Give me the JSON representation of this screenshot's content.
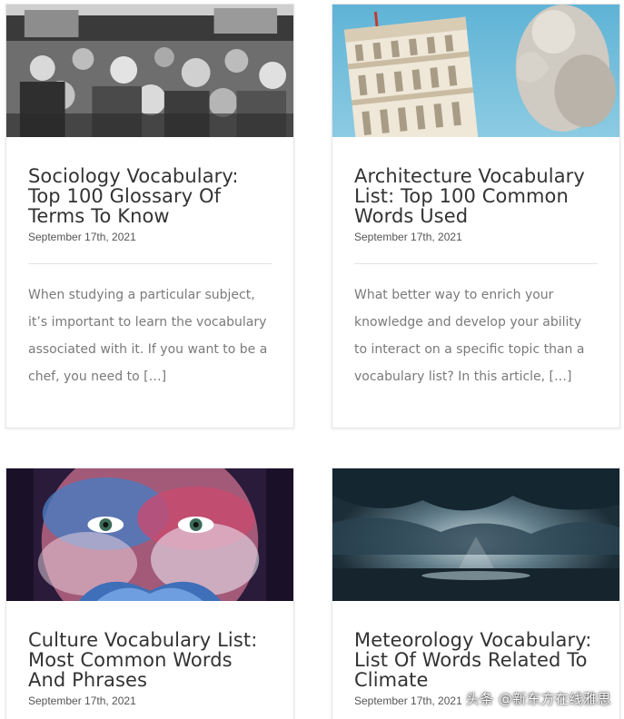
{
  "cards": [
    {
      "title": "Sociology Vocabulary: Top 100 Glossary Of Terms To Know",
      "date": "September 17th, 2021",
      "excerpt": "When studying a particular subject, it’s important to learn the vocabulary associated with it. If you want to be a chef, you need to […]",
      "image": "crowd-photo"
    },
    {
      "title": "Architecture Vocabulary List: Top 100 Common Words Used",
      "date": "September 17th, 2021",
      "excerpt": "What better way to enrich your knowledge and develop your ability to interact on a specific topic than a vocabulary list? In this article, […]",
      "image": "leaning-tower-statue-photo"
    },
    {
      "title": "Culture Vocabulary List: Most Common Words And Phrases",
      "date": "September 17th, 2021",
      "image": "painted-face-butterfly-photo"
    },
    {
      "title": "Meteorology Vocabulary: List Of Words Related To Climate",
      "date": "September 17th, 2021",
      "image": "sky-clouds-sea-photo"
    }
  ],
  "watermark": "头条 @新东方在线雅思",
  "colors": {
    "title": "#333333",
    "date": "#555555",
    "excerpt": "#7a7a7a",
    "divider": "#e2e2e2",
    "card_border": "#e6e6e6"
  }
}
